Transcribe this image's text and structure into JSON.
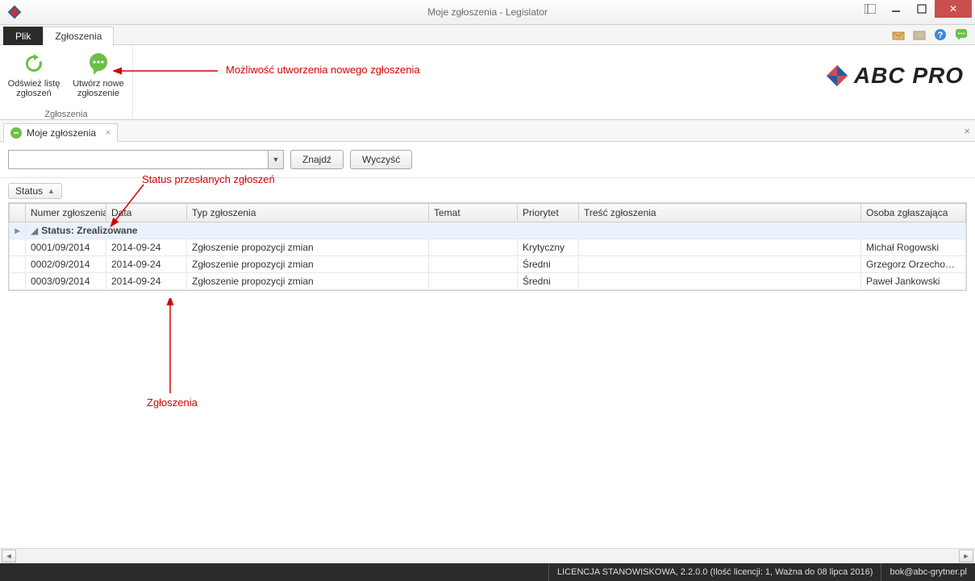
{
  "window": {
    "title": "Moje zgłoszenia - Legislator"
  },
  "menu": {
    "file": "Plik",
    "reports": "Zgłoszenia"
  },
  "ribbon": {
    "refresh": "Odśwież listę\nzgłoszeń",
    "create": "Utwórz nowe\nzgłoszenie",
    "group_title": "Zgłoszenia"
  },
  "doc_tab": {
    "label": "Moje zgłoszenia"
  },
  "search": {
    "find": "Znajdź",
    "clear": "Wyczyść",
    "value": ""
  },
  "group_chip": "Status",
  "annotations": {
    "create": "Możliwość utworzenia nowego zgłoszenia",
    "status": "Status przesłanych zgłoszeń",
    "list": "Zgłoszenia"
  },
  "columns": {
    "number": "Numer zgłoszenia",
    "date": "Data",
    "type": "Typ zgłoszenia",
    "subject": "Temat",
    "priority": "Priorytet",
    "content": "Treść zgłoszenia",
    "reporter": "Osoba zgłaszająca"
  },
  "group_header": "Status: Zrealizowane",
  "rows": [
    {
      "number": "0001/09/2014",
      "date": "2014-09-24",
      "type": "Zgłoszenie propozycji zmian",
      "subject": "",
      "priority": "Krytyczny",
      "content": "",
      "reporter": "Michał Rogowski"
    },
    {
      "number": "0002/09/2014",
      "date": "2014-09-24",
      "type": "Zgłoszenie propozycji zmian",
      "subject": "",
      "priority": "Średni",
      "content": "",
      "reporter": "Grzegorz Orzechowski"
    },
    {
      "number": "0003/09/2014",
      "date": "2014-09-24",
      "type": "Zgłoszenie propozycji zmian",
      "subject": "",
      "priority": "Średni",
      "content": "",
      "reporter": "Paweł Jankowski"
    }
  ],
  "status": {
    "license": "LICENCJA STANOWISKOWA, 2.2.0.0 (Ilość licencji: 1, Ważna do 08 lipca 2016)",
    "email": "bok@abc-grytner.pl"
  },
  "logo": {
    "text": "ABC PRO"
  }
}
